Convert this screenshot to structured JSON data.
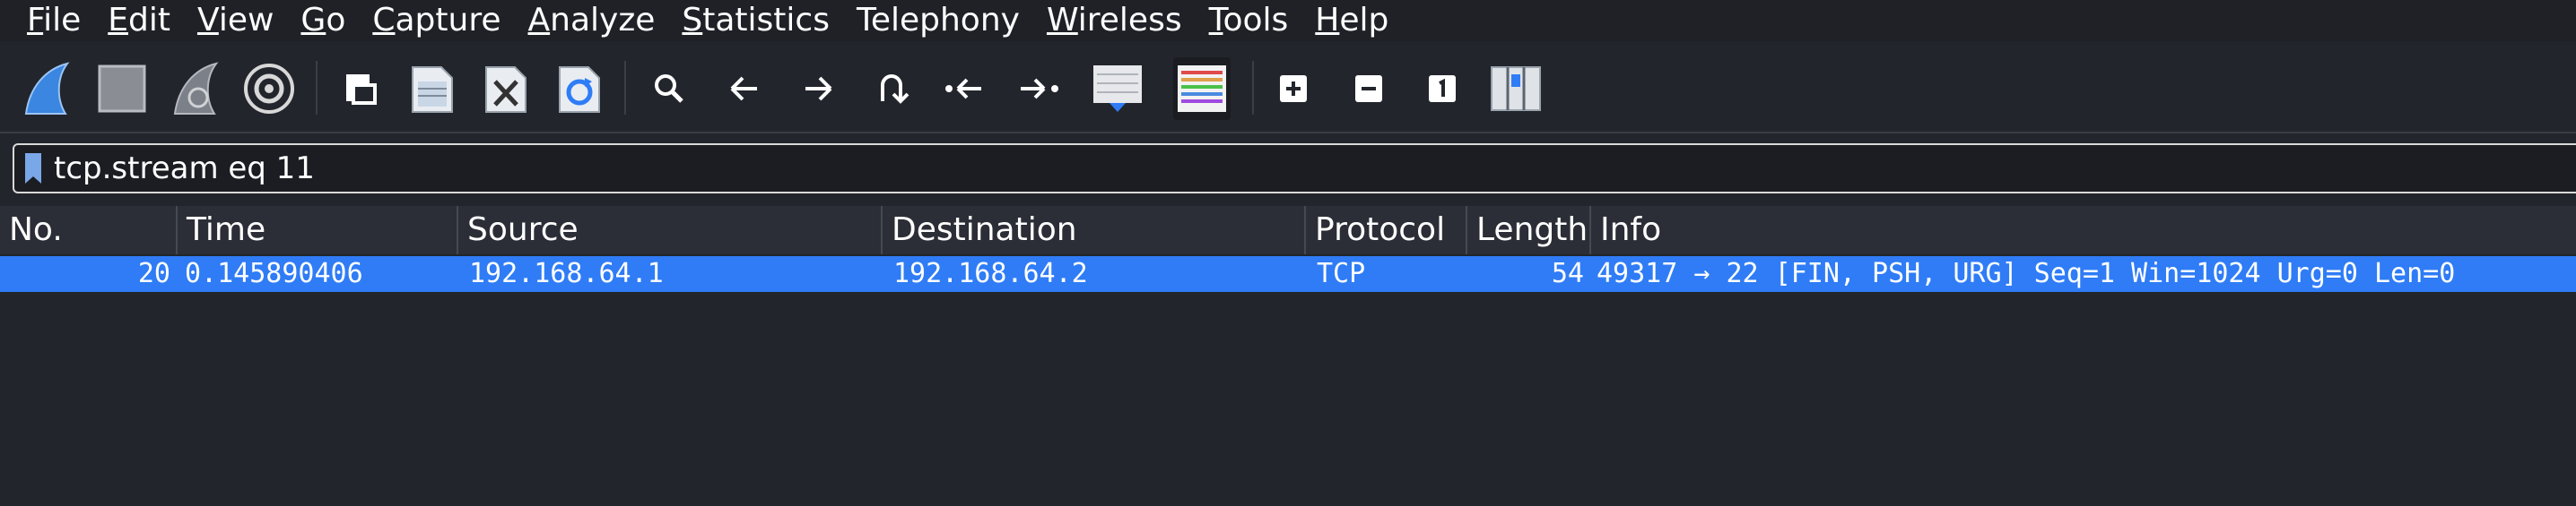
{
  "menu": [
    {
      "u": "F",
      "rest": "ile"
    },
    {
      "u": "E",
      "rest": "dit"
    },
    {
      "u": "V",
      "rest": "iew"
    },
    {
      "u": "G",
      "rest": "o"
    },
    {
      "u": "C",
      "rest": "apture"
    },
    {
      "u": "A",
      "rest": "nalyze"
    },
    {
      "u": "S",
      "rest": "tatistics"
    },
    {
      "u": "",
      "rest": "Telephony"
    },
    {
      "u": "W",
      "rest": "ireless"
    },
    {
      "u": "T",
      "rest": "ools"
    },
    {
      "u": "H",
      "rest": "elp"
    }
  ],
  "toolbar": {
    "icons": [
      "shark-fin-start-icon",
      "stop-square-icon",
      "restart-fin-icon",
      "gear-options-icon",
      "open-file-icon",
      "save-file-icon",
      "close-file-icon",
      "reload-file-icon",
      "search-icon",
      "back-arrow-icon",
      "forward-arrow-icon",
      "jump-to-packet-icon",
      "first-packet-icon",
      "last-packet-icon",
      "autoscroll-icon",
      "colorize-icon",
      "zoom-in-icon",
      "zoom-out-icon",
      "normal-size-icon",
      "resize-columns-icon"
    ]
  },
  "filter": {
    "value": "tcp.stream eq 11"
  },
  "columns": [
    "No.",
    "Time",
    "Source",
    "Destination",
    "Protocol",
    "Length",
    "Info"
  ],
  "packets": [
    {
      "no": "20",
      "time": "0.145890406",
      "source": "192.168.64.1",
      "destination": "192.168.64.2",
      "protocol": "TCP",
      "length": "54",
      "info": "49317 → 22 [FIN, PSH, URG] Seq=1 Win=1024 Urg=0 Len=0"
    }
  ],
  "colors": {
    "background": "#22252c",
    "selected_row": "#2f7cf6",
    "accent_blue": "#1e6fd9"
  }
}
